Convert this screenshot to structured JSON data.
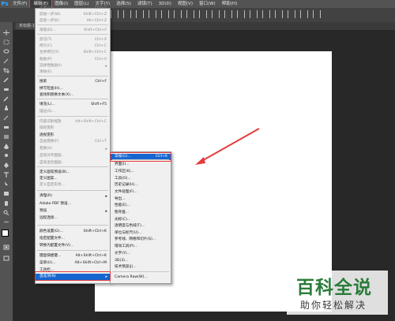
{
  "app": {
    "logo": "Ps"
  },
  "menubar": [
    "文件(F)",
    "编辑(E)",
    "图像(I)",
    "图层(L)",
    "文字(Y)",
    "选择(S)",
    "滤镜(T)",
    "3D(D)",
    "视图(V)",
    "窗口(W)",
    "帮助(H)"
  ],
  "active_menu_index": 1,
  "document_tab": "未标题-1",
  "edit_menu": [
    {
      "label": "还原(O)",
      "shortcut": "Ctrl+Z",
      "disabled": true
    },
    {
      "label": "前进一步(W)",
      "shortcut": "Shift+Ctrl+Z",
      "disabled": true
    },
    {
      "label": "后退一步(K)",
      "shortcut": "Alt+Ctrl+Z",
      "disabled": true
    },
    {
      "label": "渐隐(D)...",
      "shortcut": "Shift+Ctrl+F",
      "disabled": true
    },
    {
      "label": "剪切(T)",
      "shortcut": "Ctrl+X",
      "disabled": true
    },
    {
      "label": "拷贝(C)",
      "shortcut": "Ctrl+C",
      "disabled": true
    },
    {
      "label": "合并拷贝(Y)",
      "shortcut": "Shift+Ctrl+C",
      "disabled": true
    },
    {
      "label": "粘贴(P)",
      "shortcut": "Ctrl+V",
      "disabled": true
    },
    {
      "label": "选择性粘贴(I)",
      "shortcut": "",
      "disabled": true,
      "submenu": true
    },
    {
      "label": "清除(E)",
      "shortcut": "",
      "disabled": true
    },
    {
      "label": "搜索",
      "shortcut": "Ctrl+F",
      "disabled": false
    },
    {
      "label": "拼写检查(H)...",
      "shortcut": "",
      "disabled": false
    },
    {
      "label": "查找和替换文本(X)...",
      "shortcut": "",
      "disabled": false
    },
    {
      "label": "填充(L)...",
      "shortcut": "Shift+F5",
      "disabled": false
    },
    {
      "label": "描边(S)...",
      "shortcut": "",
      "disabled": true
    },
    {
      "label": "内容识别缩放",
      "shortcut": "Alt+Shift+Ctrl+C",
      "disabled": true
    },
    {
      "label": "操控变形",
      "shortcut": "",
      "disabled": true
    },
    {
      "label": "透视变形",
      "shortcut": "",
      "disabled": false
    },
    {
      "label": "自由变换(F)",
      "shortcut": "Ctrl+T",
      "disabled": true
    },
    {
      "label": "变换(A)",
      "shortcut": "",
      "disabled": true,
      "submenu": true
    },
    {
      "label": "自动对齐图层...",
      "shortcut": "",
      "disabled": true
    },
    {
      "label": "自动混合图层...",
      "shortcut": "",
      "disabled": true
    },
    {
      "label": "定义画笔预设(B)...",
      "shortcut": "",
      "disabled": false
    },
    {
      "label": "定义图案...",
      "shortcut": "",
      "disabled": false
    },
    {
      "label": "定义自定形状...",
      "shortcut": "",
      "disabled": true
    },
    {
      "label": "清理(R)",
      "shortcut": "",
      "disabled": false,
      "submenu": true
    },
    {
      "label": "Adobe PDF 预设...",
      "shortcut": "",
      "disabled": false
    },
    {
      "label": "预设",
      "shortcut": "",
      "disabled": false,
      "submenu": true
    },
    {
      "label": "远程连接...",
      "shortcut": "",
      "disabled": false
    },
    {
      "label": "颜色设置(G)...",
      "shortcut": "Shift+Ctrl+K",
      "disabled": false
    },
    {
      "label": "指定配置文件...",
      "shortcut": "",
      "disabled": false
    },
    {
      "label": "转换为配置文件(V)...",
      "shortcut": "",
      "disabled": false
    },
    {
      "label": "键盘快捷键...",
      "shortcut": "Alt+Shift+Ctrl+K",
      "disabled": false
    },
    {
      "label": "菜单(U)...",
      "shortcut": "Alt+Shift+Ctrl+M",
      "disabled": false
    },
    {
      "label": "工具栏...",
      "shortcut": "",
      "disabled": false
    },
    {
      "label": "首选项(N)",
      "shortcut": "",
      "disabled": false,
      "submenu": true,
      "highlighted": true
    }
  ],
  "prefs_submenu": [
    {
      "label": "常规(G)...",
      "shortcut": "Ctrl+K",
      "highlighted": true
    },
    {
      "label": "界面(I)...",
      "shortcut": ""
    },
    {
      "label": "工作区(K)...",
      "shortcut": ""
    },
    {
      "label": "工具(O)...",
      "shortcut": ""
    },
    {
      "label": "历史记录(H)...",
      "shortcut": ""
    },
    {
      "label": "文件处理(F)...",
      "shortcut": ""
    },
    {
      "label": "导出...",
      "shortcut": ""
    },
    {
      "label": "性能(E)...",
      "shortcut": ""
    },
    {
      "label": "暂存盘...",
      "shortcut": ""
    },
    {
      "label": "光标(C)...",
      "shortcut": ""
    },
    {
      "label": "透明度与色域(T)...",
      "shortcut": ""
    },
    {
      "label": "单位与标尺(U)...",
      "shortcut": ""
    },
    {
      "label": "参考线、网格和切片(S)...",
      "shortcut": ""
    },
    {
      "label": "增效工具(P)...",
      "shortcut": ""
    },
    {
      "label": "文字(Y)...",
      "shortcut": ""
    },
    {
      "label": "3D(3)...",
      "shortcut": ""
    },
    {
      "label": "技术预览(J)...",
      "shortcut": ""
    },
    {
      "label": "Camera Raw(W)...",
      "shortcut": ""
    }
  ],
  "watermark": {
    "title": "百科全说",
    "subtitle": "助你轻松解决"
  },
  "colors": {
    "highlight": "#1666d0",
    "annotation": "#e53b3b"
  }
}
